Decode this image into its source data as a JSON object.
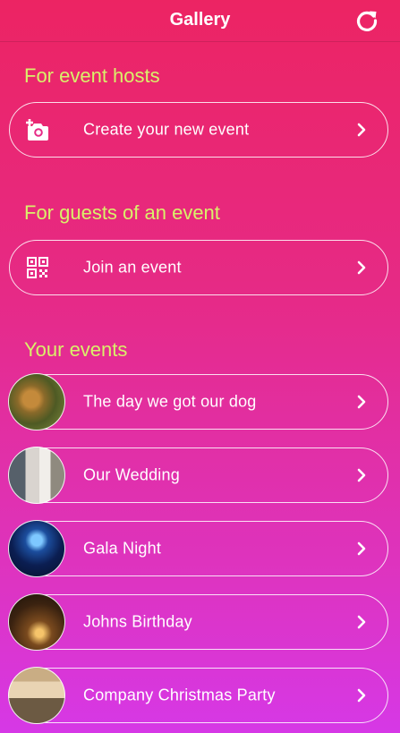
{
  "header": {
    "title": "Gallery",
    "refresh_icon": "refresh-icon"
  },
  "hosts": {
    "heading": "For event hosts",
    "action": {
      "label": "Create your new event",
      "icon": "add-photo-camera-icon"
    }
  },
  "guests": {
    "heading": "For guests of an event",
    "action": {
      "label": "Join an event",
      "icon": "qr-code-icon"
    }
  },
  "your_events": {
    "heading": "Your events",
    "items": [
      {
        "label": "The day we got our dog"
      },
      {
        "label": "Our Wedding"
      },
      {
        "label": "Gala Night"
      },
      {
        "label": "Johns Birthday"
      },
      {
        "label": "Company Christmas Party"
      }
    ]
  },
  "colors": {
    "gradient_top": "#ec2463",
    "gradient_bottom": "#d638e6",
    "heading": "#d9f16a",
    "text": "#ffffff"
  }
}
